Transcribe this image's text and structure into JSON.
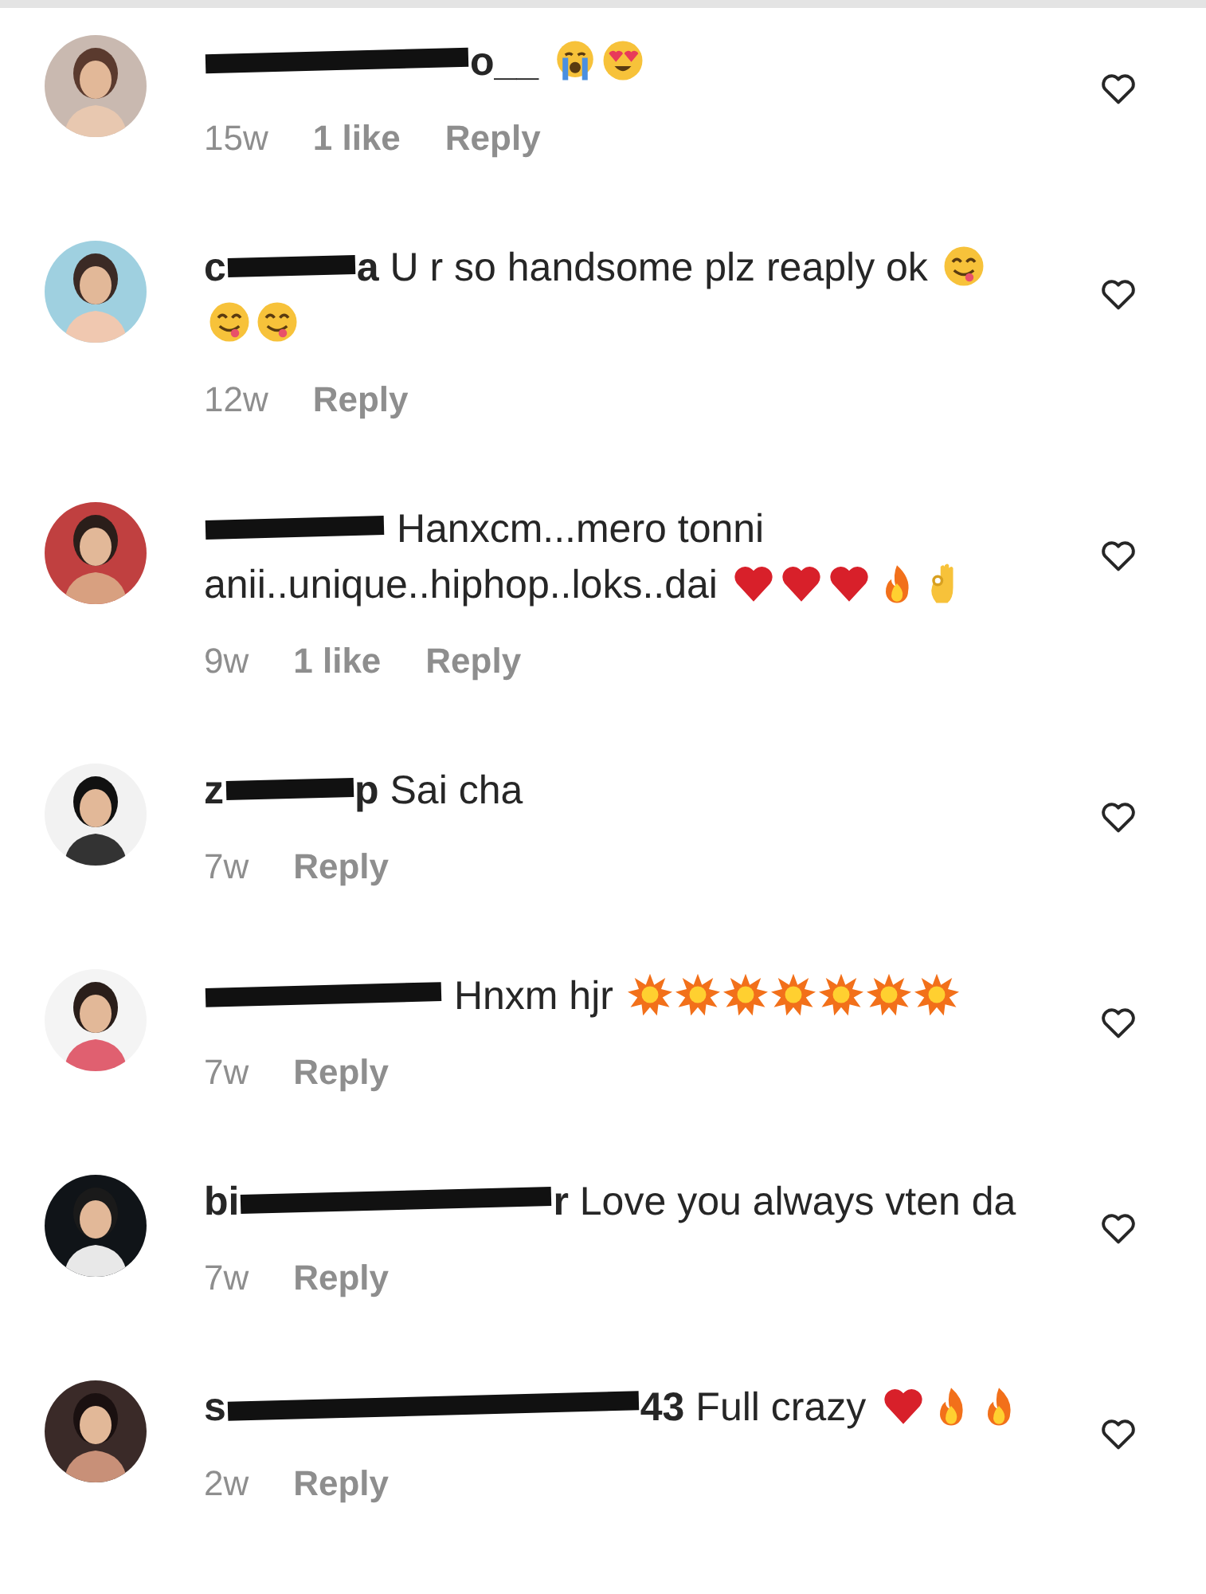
{
  "comments": [
    {
      "username": [
        {
          "kind": "medium"
        },
        {
          "kind": "text",
          "text": "o__"
        }
      ],
      "emojis": [
        {
          "kind": "crying"
        },
        {
          "kind": "heart-eyes"
        }
      ],
      "time": "15w",
      "likes": "1 like",
      "reply": "Reply"
    },
    {
      "username": [
        {
          "kind": "text",
          "text": "c"
        },
        {
          "kind": "tiny"
        },
        {
          "kind": "text",
          "text": "a"
        }
      ],
      "text_lines": [
        "U r so handsome plz reaply ok"
      ],
      "emojis": [
        {
          "kind": "yum"
        },
        {
          "kind": "yum"
        },
        {
          "kind": "yum"
        }
      ],
      "time": "12w",
      "reply": "Reply"
    },
    {
      "username": [
        {
          "kind": "short"
        }
      ],
      "text_lines": [
        "Hanxcm...mero tonni",
        "anii..unique..hiphop..loks..dai"
      ],
      "emojis": [
        {
          "kind": "red-heart"
        },
        {
          "kind": "red-heart"
        },
        {
          "kind": "red-heart"
        },
        {
          "kind": "fire"
        },
        {
          "kind": "ok-hand"
        }
      ],
      "time": "9w",
      "likes": "1 like",
      "reply": "Reply"
    },
    {
      "username": [
        {
          "kind": "text",
          "text": "z"
        },
        {
          "kind": "tiny"
        },
        {
          "kind": "text",
          "text": "p"
        }
      ],
      "text_lines": [
        "Sai cha"
      ],
      "time": "7w",
      "reply": "Reply"
    },
    {
      "username": [
        {
          "kind": "long"
        }
      ],
      "text_lines": [
        "Hnxm hjr"
      ],
      "emojis": [
        {
          "kind": "collision"
        },
        {
          "kind": "collision"
        },
        {
          "kind": "collision"
        },
        {
          "kind": "collision"
        },
        {
          "kind": "collision"
        },
        {
          "kind": "collision"
        },
        {
          "kind": "collision"
        }
      ],
      "time": "7w",
      "reply": "Reply"
    },
    {
      "username": [
        {
          "kind": "text",
          "text": "bi"
        },
        {
          "kind": "wide"
        },
        {
          "kind": "text",
          "text": "r"
        }
      ],
      "text_lines": [
        "Love you always vten da"
      ],
      "time": "7w",
      "reply": "Reply"
    },
    {
      "username": [
        {
          "kind": "text",
          "text": "s"
        },
        {
          "kind": "widest"
        },
        {
          "kind": "text",
          "text": "43"
        }
      ],
      "text_lines": [
        "Full crazy"
      ],
      "emojis": [
        {
          "kind": "red-heart"
        },
        {
          "kind": "fire"
        },
        {
          "kind": "fire"
        }
      ],
      "time": "2w",
      "reply": "Reply"
    }
  ]
}
